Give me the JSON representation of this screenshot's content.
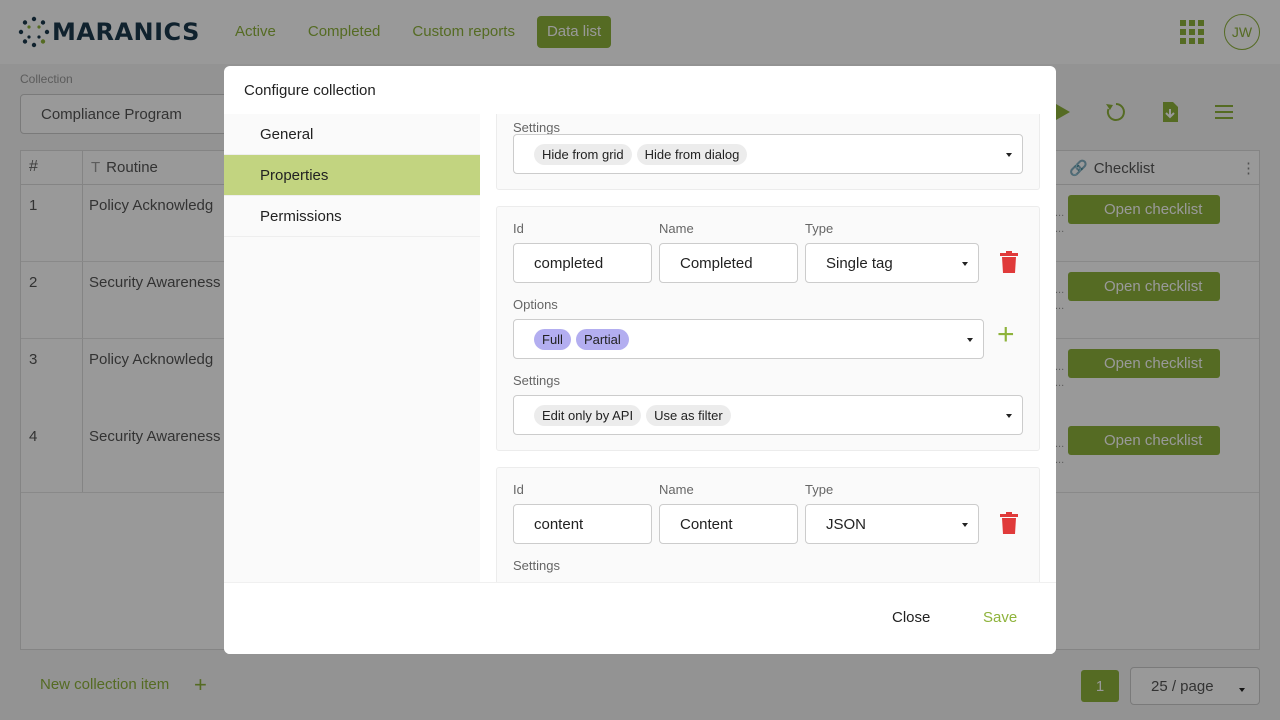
{
  "brand": {
    "name": "MARANICS",
    "accent": "#8eb33b",
    "dark": "#1b3a4e"
  },
  "nav": {
    "items": [
      "Active",
      "Completed",
      "Custom reports",
      "Data list"
    ],
    "active_index": 3
  },
  "user": {
    "initials": "JW"
  },
  "background": {
    "collection_label": "Collection",
    "collection_value": "Compliance Program",
    "columns": {
      "hash": "#",
      "routine": "Routine",
      "checklist": "Checklist"
    },
    "rows": [
      {
        "num": "1",
        "name": "Policy Acknowledg",
        "action": "Open checklist"
      },
      {
        "num": "2",
        "name": "Security Awareness",
        "action": "Open checklist"
      },
      {
        "num": "3",
        "name": "Policy Acknowledg",
        "action": "Open checklist"
      },
      {
        "num": "4",
        "name": "Security Awareness",
        "action": "Open checklist"
      }
    ],
    "new_item": "New collection item",
    "page": "1",
    "page_size": "25 / page"
  },
  "modal": {
    "title": "Configure collection",
    "sidebar": [
      {
        "label": "General",
        "active": false
      },
      {
        "label": "Properties",
        "active": true
      },
      {
        "label": "Permissions",
        "active": false
      }
    ],
    "labels": {
      "settings": "Settings",
      "id": "Id",
      "name": "Name",
      "type": "Type",
      "options": "Options"
    },
    "card0": {
      "settings_tags": [
        "Hide from grid",
        "Hide from dialog"
      ]
    },
    "card1": {
      "id": "completed",
      "name": "Completed",
      "type": "Single tag",
      "options": [
        "Full",
        "Partial"
      ],
      "settings_tags": [
        "Edit only by API",
        "Use as filter"
      ]
    },
    "card2": {
      "id": "content",
      "name": "Content",
      "type": "JSON"
    },
    "close_label": "Close",
    "save_label": "Save"
  }
}
